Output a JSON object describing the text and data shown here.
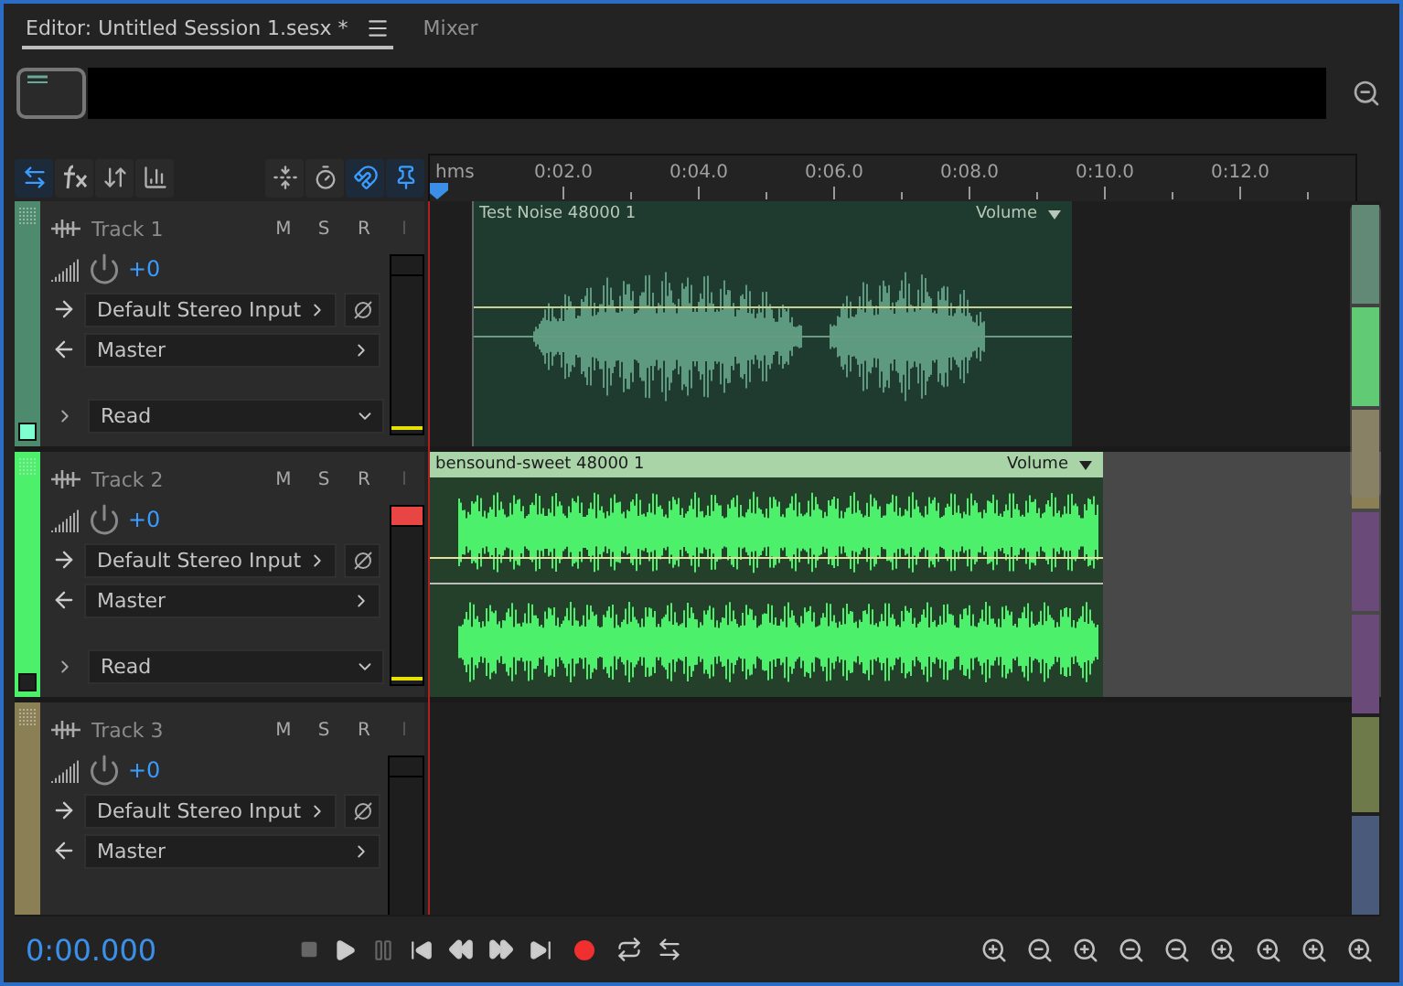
{
  "tabs": [
    {
      "label": "Editor: Untitled Session 1.sesx *",
      "selected": true
    },
    {
      "label": "Mixer",
      "selected": false
    }
  ],
  "ruler": {
    "labels": [
      "hms",
      "0:02.0",
      "0:04.0",
      "0:06.0",
      "0:08.0",
      "0:10.0",
      "0:12.0"
    ]
  },
  "tracks": [
    {
      "name": "Track 1",
      "color": "#4e8a6e",
      "checked": true,
      "volume": "+0",
      "input": "Default Stereo Input",
      "output": "Master",
      "automation": "Read",
      "buttons": [
        {
          "label": "M",
          "disabled": false
        },
        {
          "label": "S",
          "disabled": false
        },
        {
          "label": "R",
          "disabled": false
        },
        {
          "label": "I",
          "disabled": true
        }
      ],
      "clipped": false,
      "selected": false,
      "clip": {
        "name": "Test Noise 48000 1",
        "envelope": "Volume",
        "selected": false
      }
    },
    {
      "name": "Track 2",
      "color": "#4cf06a",
      "checked": false,
      "volume": "+0",
      "input": "Default Stereo Input",
      "output": "Master",
      "automation": "Read",
      "buttons": [
        {
          "label": "M",
          "disabled": false
        },
        {
          "label": "S",
          "disabled": false
        },
        {
          "label": "R",
          "disabled": false
        },
        {
          "label": "I",
          "disabled": true
        }
      ],
      "clipped": true,
      "selected": true,
      "clip": {
        "name": "bensound-sweet 48000 1",
        "envelope": "Volume",
        "selected": true
      }
    },
    {
      "name": "Track 3",
      "color": "#8a7f55",
      "volume": "+0",
      "input": "Default Stereo Input",
      "output": "Master",
      "buttons": [
        {
          "label": "M",
          "disabled": false
        },
        {
          "label": "S",
          "disabled": false
        },
        {
          "label": "R",
          "disabled": false
        },
        {
          "label": "I",
          "disabled": true
        }
      ],
      "clipped": false,
      "selected": false
    }
  ],
  "transport": {
    "time": "0:00.000"
  }
}
